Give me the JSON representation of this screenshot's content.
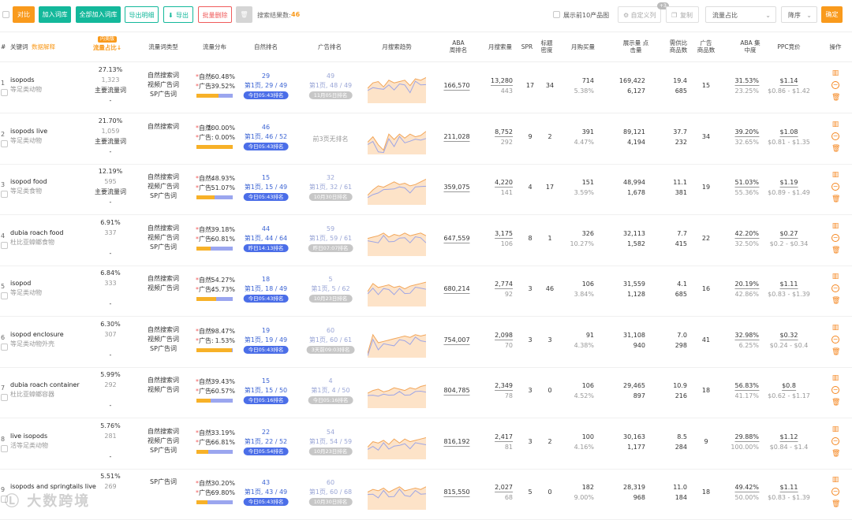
{
  "toolbar": {
    "buttons": [
      "对比",
      "加入词库",
      "全部加入词库",
      "导出明细",
      "导出",
      "批量删除"
    ],
    "result_label": "搜索结果数:",
    "result_count": "46",
    "top10_label": "展示前10产品图",
    "custom_col": "自定义列",
    "custom_badge": "+3",
    "copy": "复制",
    "sort_field": "流量占比",
    "sort_order": "降序",
    "confirm": "确定"
  },
  "header": {
    "keyword": "关键词",
    "data_explain": "数据解释",
    "traffic_tag": "内美版",
    "traffic_share": "流量占比",
    "traffic_type": "流量词类型",
    "traffic_dist": "流量分布",
    "natural_rank": "自然排名",
    "ad_rank": "广告排名",
    "monthly_trend": "月搜索趋势",
    "aba_week": "ABA 周排名",
    "monthly_search": "月搜索量",
    "spr": "SPR",
    "title_density": "标题 密度",
    "monthly_buy": "月购买量",
    "impr_clicks": "展示量 点击量",
    "demand_supply": "需供比 商品数",
    "ad_products": "广告 商品数",
    "aba_conc": "ABA 集中度",
    "ppc": "PPC竞价",
    "ops": "操作"
  },
  "rows": [
    {
      "idx": "1",
      "kw": "isopods",
      "cn": "等足类动物",
      "share": "27.13%",
      "share_n": "1,323",
      "main": "主要流量词",
      "dash": "-",
      "types": [
        "自然搜索词",
        "视频广告词",
        "SP广告词"
      ],
      "nat_pct": "60.48%",
      "ad_pct": "39.52%",
      "nat_frac": 0.6048,
      "nr": "29",
      "nr_page": "第1页, 29 / 49",
      "nr_pill": "今日05:43排名",
      "ar": "49",
      "ar_page": "第1页, 48 / 49",
      "ar_pill": "11月05日排名",
      "aba": "166,570",
      "ms": "13,280",
      "ms2": "443",
      "spr": "17",
      "td": "34",
      "buy": "714",
      "buy_pct": "5.38%",
      "impr": "169,422",
      "clk": "6,127",
      "ds": "19.4",
      "goods": "685",
      "adp": "15",
      "conc": "31.53%",
      "conc2": "23.25%",
      "ppc": "$1.14",
      "ppc_r": "$0.86 - $1.42"
    },
    {
      "idx": "2",
      "kw": "isopods live",
      "cn": "等足类动物",
      "share": "21.70%",
      "share_n": "1,059",
      "main": "主要流量词",
      "dash": "-",
      "types": [
        "自然搜索词"
      ],
      "nat_pct": "100.00%",
      "ad_pct": "0.00%",
      "nat_frac": 1.0,
      "nr": "46",
      "nr_page": "第1页, 46 / 52",
      "nr_pill": "今日05:43排名",
      "ar": "",
      "ar_page": "前3页无排名",
      "ar_pill": "",
      "aba": "211,028",
      "ms": "8,752",
      "ms2": "292",
      "spr": "9",
      "td": "2",
      "buy": "391",
      "buy_pct": "4.47%",
      "impr": "89,121",
      "clk": "4,194",
      "ds": "37.7",
      "goods": "232",
      "adp": "34",
      "conc": "39.20%",
      "conc2": "32.65%",
      "ppc": "$1.08",
      "ppc_r": "$0.81 - $1.35"
    },
    {
      "idx": "3",
      "kw": "isopod food",
      "cn": "等足类食物",
      "share": "12.19%",
      "share_n": "595",
      "main": "主要流量词",
      "dash": "-",
      "types": [
        "自然搜索词",
        "视频广告词",
        "SP广告词"
      ],
      "nat_pct": "48.93%",
      "ad_pct": "51.07%",
      "nat_frac": 0.4893,
      "nr": "15",
      "nr_page": "第1页, 15 / 49",
      "nr_pill": "今日05:43排名",
      "ar": "32",
      "ar_page": "第1页, 32 / 61",
      "ar_pill": "10月30日排名",
      "aba": "359,075",
      "ms": "4,220",
      "ms2": "141",
      "spr": "4",
      "td": "17",
      "buy": "151",
      "buy_pct": "3.59%",
      "impr": "48,994",
      "clk": "1,678",
      "ds": "11.1",
      "goods": "381",
      "adp": "19",
      "conc": "51.03%",
      "conc2": "55.36%",
      "ppc": "$1.19",
      "ppc_r": "$0.89 - $1.49"
    },
    {
      "idx": "4",
      "kw": "dubia roach food",
      "cn": "杜比亚蟑螂食物",
      "share": "6.91%",
      "share_n": "337",
      "main": "",
      "dash": "-",
      "types": [
        "自然搜索词",
        "视频广告词",
        "SP广告词"
      ],
      "nat_pct": "39.18%",
      "ad_pct": "60.81%",
      "nat_frac": 0.3918,
      "nr": "44",
      "nr_page": "第1页, 44 / 64",
      "nr_pill": "昨日14:13排名",
      "ar": "59",
      "ar_page": "第1页, 59 / 61",
      "ar_pill": "昨日07:07排名",
      "aba": "647,559",
      "ms": "3,175",
      "ms2": "106",
      "spr": "8",
      "td": "1",
      "buy": "326",
      "buy_pct": "10.27%",
      "impr": "32,113",
      "clk": "1,582",
      "ds": "7.7",
      "goods": "415",
      "adp": "22",
      "conc": "42.20%",
      "conc2": "32.50%",
      "ppc": "$0.27",
      "ppc_r": "$0.2 - $0.34"
    },
    {
      "idx": "5",
      "kw": "isopod",
      "cn": "等足类动物",
      "share": "6.84%",
      "share_n": "333",
      "main": "",
      "dash": "-",
      "types": [
        "自然搜索词",
        "视频广告词"
      ],
      "nat_pct": "54.27%",
      "ad_pct": "45.73%",
      "nat_frac": 0.5427,
      "nr": "18",
      "nr_page": "第1页, 18 / 49",
      "nr_pill": "今日05:43排名",
      "ar": "5",
      "ar_page": "第1页, 5 / 62",
      "ar_pill": "10月23日排名",
      "aba": "680,214",
      "ms": "2,774",
      "ms2": "92",
      "spr": "3",
      "td": "46",
      "buy": "106",
      "buy_pct": "3.84%",
      "impr": "31,559",
      "clk": "1,128",
      "ds": "4.1",
      "goods": "685",
      "adp": "16",
      "conc": "20.19%",
      "conc2": "42.86%",
      "ppc": "$1.11",
      "ppc_r": "$0.83 - $1.39"
    },
    {
      "idx": "6",
      "kw": "isopod enclosure",
      "cn": "等足类动物外壳",
      "share": "6.30%",
      "share_n": "307",
      "main": "",
      "dash": "-",
      "types": [
        "自然搜索词",
        "视频广告词",
        "SP广告词"
      ],
      "nat_pct": "98.47%",
      "ad_pct": "1.53%",
      "nat_frac": 0.9847,
      "nr": "19",
      "nr_page": "第1页, 19 / 49",
      "nr_pill": "今日05:43排名",
      "ar": "60",
      "ar_page": "第1页, 60 / 61",
      "ar_pill": "3天前09:03排名",
      "aba": "754,007",
      "ms": "2,098",
      "ms2": "70",
      "spr": "3",
      "td": "3",
      "buy": "91",
      "buy_pct": "4.38%",
      "impr": "31,108",
      "clk": "940",
      "ds": "7.0",
      "goods": "298",
      "adp": "41",
      "conc": "32.98%",
      "conc2": "6.25%",
      "ppc": "$0.32",
      "ppc_r": "$0.24 - $0.4"
    },
    {
      "idx": "7",
      "kw": "dubia roach container",
      "cn": "杜比亚蟑螂容器",
      "share": "5.99%",
      "share_n": "292",
      "main": "",
      "dash": "-",
      "types": [
        "自然搜索词",
        "视频广告词"
      ],
      "nat_pct": "39.43%",
      "ad_pct": "60.57%",
      "nat_frac": 0.3943,
      "nr": "15",
      "nr_page": "第1页, 15 / 50",
      "nr_pill": "今日05:16排名",
      "ar": "4",
      "ar_page": "第1页, 4 / 50",
      "ar_pill": "今日05:16排名",
      "aba": "804,785",
      "ms": "2,349",
      "ms2": "78",
      "spr": "3",
      "td": "0",
      "buy": "106",
      "buy_pct": "4.52%",
      "impr": "29,465",
      "clk": "897",
      "ds": "10.9",
      "goods": "216",
      "adp": "18",
      "conc": "56.83%",
      "conc2": "41.17%",
      "ppc": "$0.8",
      "ppc_r": "$0.62 - $1.17"
    },
    {
      "idx": "8",
      "kw": "live isopods",
      "cn": "活等足类动物",
      "share": "5.76%",
      "share_n": "281",
      "main": "",
      "dash": "-",
      "types": [
        "自然搜索词",
        "视频广告词",
        "SP广告词"
      ],
      "nat_pct": "33.19%",
      "ad_pct": "66.81%",
      "nat_frac": 0.3319,
      "nr": "22",
      "nr_page": "第1页, 22 / 52",
      "nr_pill": "今日05:54排名",
      "ar": "54",
      "ar_page": "第1页, 54 / 59",
      "ar_pill": "10月23日排名",
      "aba": "816,192",
      "ms": "2,417",
      "ms2": "81",
      "spr": "3",
      "td": "2",
      "buy": "100",
      "buy_pct": "4.16%",
      "impr": "30,163",
      "clk": "1,177",
      "ds": "8.5",
      "goods": "284",
      "adp": "9",
      "conc": "29.88%",
      "conc2": "100.00%",
      "ppc": "$1.12",
      "ppc_r": "$0.84 - $1.4"
    },
    {
      "idx": "9",
      "kw": "isopods and springtails live",
      "cn": "",
      "share": "5.51%",
      "share_n": "269",
      "main": "",
      "dash": "",
      "types": [
        "SP广告词"
      ],
      "nat_pct": "30.20%",
      "ad_pct": "69.80%",
      "nat_frac": 0.302,
      "nr": "43",
      "nr_page": "第1页, 43 / 49",
      "nr_pill": "今日05:43排名",
      "ar": "60",
      "ar_page": "第1页, 60 / 68",
      "ar_pill": "10月30日排名",
      "aba": "815,550",
      "ms": "2,027",
      "ms2": "68",
      "spr": "5",
      "td": "0",
      "buy": "182",
      "buy_pct": "9.00%",
      "impr": "28,319",
      "clk": "968",
      "ds": "11.0",
      "goods": "184",
      "adp": "18",
      "conc": "49.42%",
      "conc2": "50.00%",
      "ppc": "$1.11",
      "ppc_r": "$0.83 - $1.39"
    }
  ],
  "labels": {
    "nat": "自然:",
    "ad": "广告:"
  },
  "watermark": "大数跨境",
  "colors": {
    "orange": "#f99a1c",
    "teal": "#14b89b",
    "red": "#f05b5b",
    "blue": "#3b63d3",
    "bar_nat": "#f7b128",
    "bar_ad": "#9ba6ef",
    "spark_fill": "#fde3c8",
    "spark_line": "#f2a65a",
    "spark_line2": "#9ea6e6"
  }
}
